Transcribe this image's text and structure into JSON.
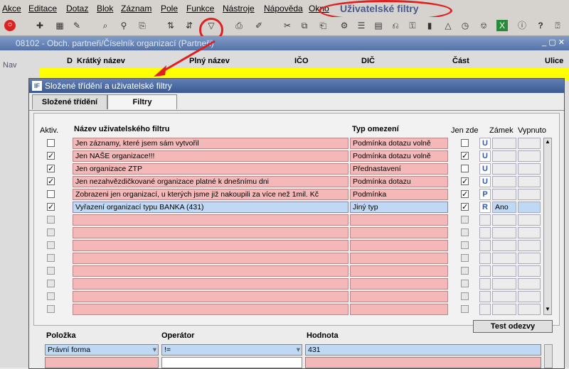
{
  "menu": {
    "items": [
      "Akce",
      "Editace",
      "Dotaz",
      "Blok",
      "Záznam",
      "Pole",
      "Funkce",
      "Nástroje",
      "Nápověda",
      "Okno"
    ],
    "annotation": "Uživatelské filtry"
  },
  "background_window": {
    "title": "08102 - Obch. partneři/Číselník organizací (Partneři)",
    "nav_label": "Nav",
    "columns": [
      "D",
      "Krátký název",
      "Plný název",
      "IČO",
      "DIČ",
      "Část",
      "Ulice"
    ]
  },
  "dialog": {
    "title": "Složené třídění a uživatelské filtry",
    "tabs": [
      "Složené třídění",
      "Filtry"
    ],
    "headers": {
      "active": "Aktiv.",
      "name": "Název uživatelského filtru",
      "type": "Typ omezení",
      "local": "Jen zde",
      "lock": "Zámek",
      "off": "Vypnuto"
    },
    "rows": [
      {
        "active": false,
        "name": "Jen záznamy, které jsem sám vytvořil",
        "type": "Podmínka dotazu volně",
        "local": false,
        "lock": "U",
        "off": ""
      },
      {
        "active": true,
        "name": "Jen NAŠE organizace!!!",
        "type": "Podmínka dotazu volně",
        "local": true,
        "lock": "U",
        "off": ""
      },
      {
        "active": true,
        "name": "Jen organizace ZTP",
        "type": "Přednastavení",
        "local": false,
        "lock": "U",
        "off": ""
      },
      {
        "active": true,
        "name": "Jen nezahvězdičkované organizace platné k dnešnímu dni",
        "type": "Podmínka dotazu",
        "local": true,
        "lock": "U",
        "off": ""
      },
      {
        "active": false,
        "name": "Zobrazeni jen organizací, u kterých jsme již nakoupili za více než 1mil. Kč",
        "type": "Podmínka",
        "local": true,
        "lock": "P",
        "off": ""
      },
      {
        "active": true,
        "name": "Vyřazení organizací typu BANKA (431)",
        "type": "Jiný typ",
        "local": true,
        "lock": "R",
        "off": "Ano"
      }
    ],
    "empty_rows": 8,
    "test_button": "Test odezvy",
    "bottom": {
      "headers": [
        "Položka",
        "Operátor",
        "Hodnota"
      ],
      "field_value": "Právní forma",
      "operator_value": "!=",
      "value_value": "431"
    }
  }
}
